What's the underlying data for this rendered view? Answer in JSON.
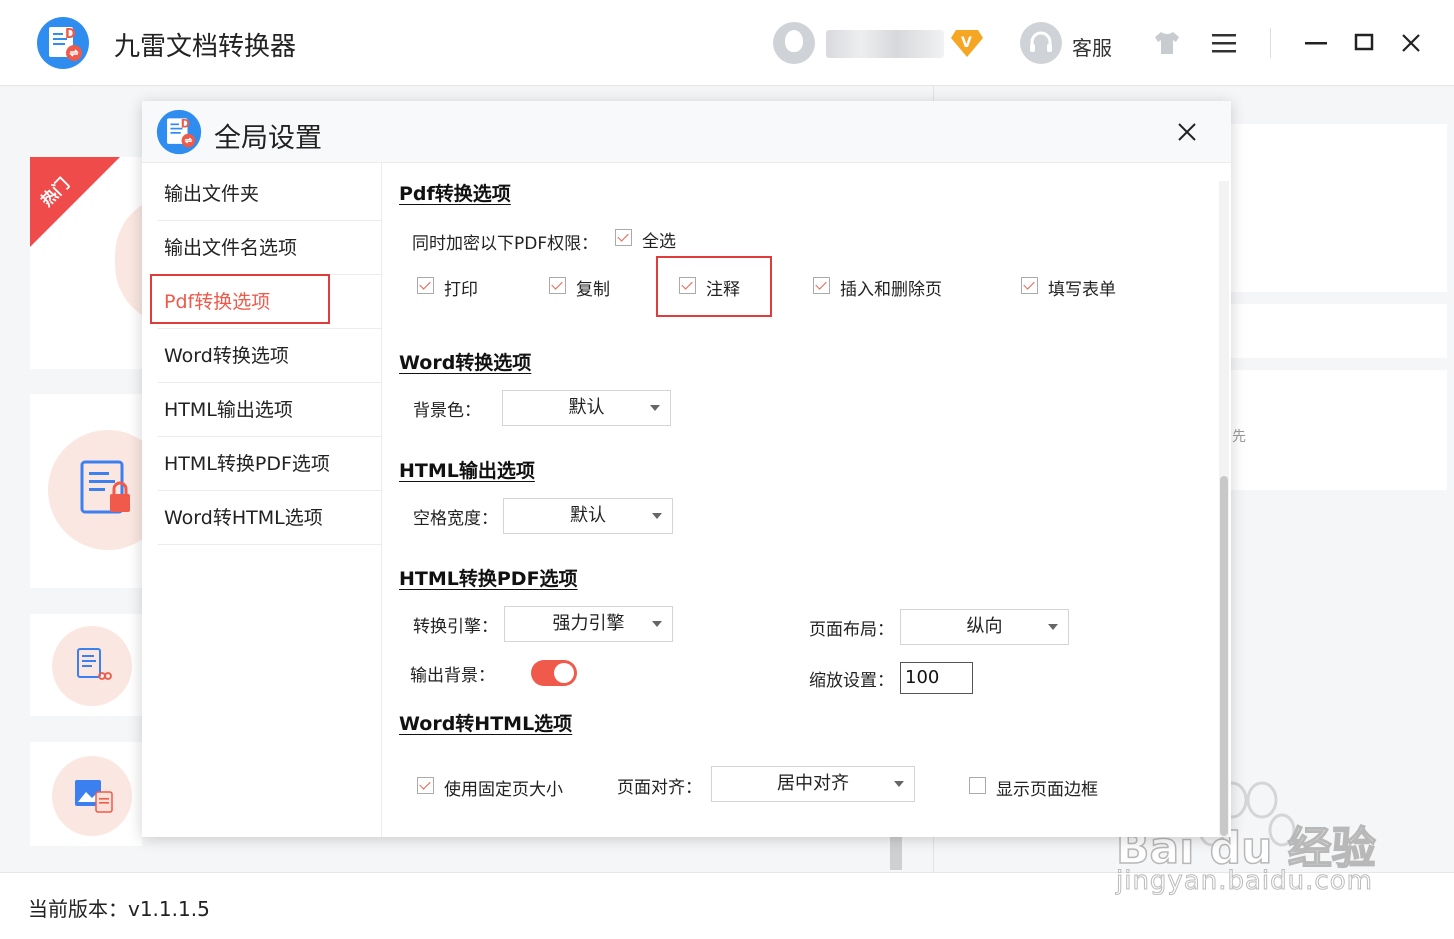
{
  "app": {
    "title": "九雷文档转换器",
    "service_label": "客服",
    "vip_letter": "V"
  },
  "background": {
    "hot_label": "热门",
    "right_fragment": "先",
    "version_label": "当前版本：v1.1.1.5"
  },
  "watermark": {
    "brand": "Bai du 经验",
    "url": "jingyan.baidu.com"
  },
  "dialog": {
    "title": "全局设置",
    "sidebar": [
      {
        "label": "输出文件夹"
      },
      {
        "label": "输出文件名选项"
      },
      {
        "label": "Pdf转换选项"
      },
      {
        "label": "Word转换选项"
      },
      {
        "label": "HTML输出选项"
      },
      {
        "label": "HTML转换PDF选项"
      },
      {
        "label": "Word转HTML选项"
      }
    ],
    "pdf": {
      "section_title": "Pdf转换选项",
      "encrypt_label": "同时加密以下PDF权限：",
      "select_all": {
        "label": "全选",
        "checked": true
      },
      "permissions": [
        {
          "label": "打印",
          "checked": true
        },
        {
          "label": "复制",
          "checked": true
        },
        {
          "label": "注释",
          "checked": true
        },
        {
          "label": "插入和删除页",
          "checked": true
        },
        {
          "label": "填写表单",
          "checked": true
        }
      ]
    },
    "word": {
      "section_title": "Word转换选项",
      "bg_label": "背景色：",
      "bg_value": "默认"
    },
    "html_output": {
      "section_title": "HTML输出选项",
      "space_label": "空格宽度：",
      "space_value": "默认"
    },
    "html_pdf": {
      "section_title": "HTML转换PDF选项",
      "engine_label": "转换引擎：",
      "engine_value": "强力引擎",
      "layout_label": "页面布局：",
      "layout_value": "纵向",
      "bg_output_label": "输出背景：",
      "bg_output_on": true,
      "zoom_label": "缩放设置：",
      "zoom_value": "100"
    },
    "word_html": {
      "section_title": "Word转HTML选项",
      "fixed_size": {
        "label": "使用固定页大小",
        "checked": true
      },
      "align_label": "页面对齐：",
      "align_value": "居中对齐",
      "show_border": {
        "label": "显示页面边框",
        "checked": false
      }
    }
  },
  "colors": {
    "accent": "#ef5a4a",
    "highlight_border": "#e03c3c",
    "vip": "#f5a623"
  }
}
